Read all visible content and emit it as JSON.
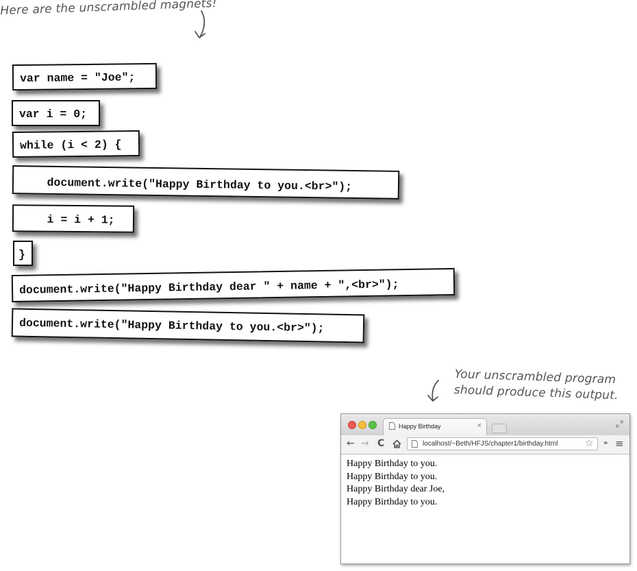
{
  "annotations": {
    "top_note": "Here are the unscrambled magnets!",
    "output_note_line1": "Your unscrambled program",
    "output_note_line2": "should produce this output."
  },
  "magnets": [
    "var name = \"Joe\";",
    "var i = 0;",
    "while (i < 2) {",
    "    document.write(\"Happy Birthday to you.<br>\");",
    "    i = i + 1;",
    "}",
    "document.write(\"Happy Birthday dear \" + name + \",<br>\");",
    "document.write(\"Happy Birthday to you.<br>\");"
  ],
  "browser": {
    "tab_title": "Happy Birthday",
    "tab_close": "×",
    "url": "localhost/~Beth/HFJS/chapter1/birthday.html",
    "output_lines": [
      "Happy Birthday to you.",
      "Happy Birthday to you.",
      "Happy Birthday dear Joe,",
      "Happy Birthday to you."
    ],
    "colors": {
      "close": "#ec5a56",
      "minimize": "#f4bd3d",
      "zoom": "#5ec24a"
    }
  }
}
